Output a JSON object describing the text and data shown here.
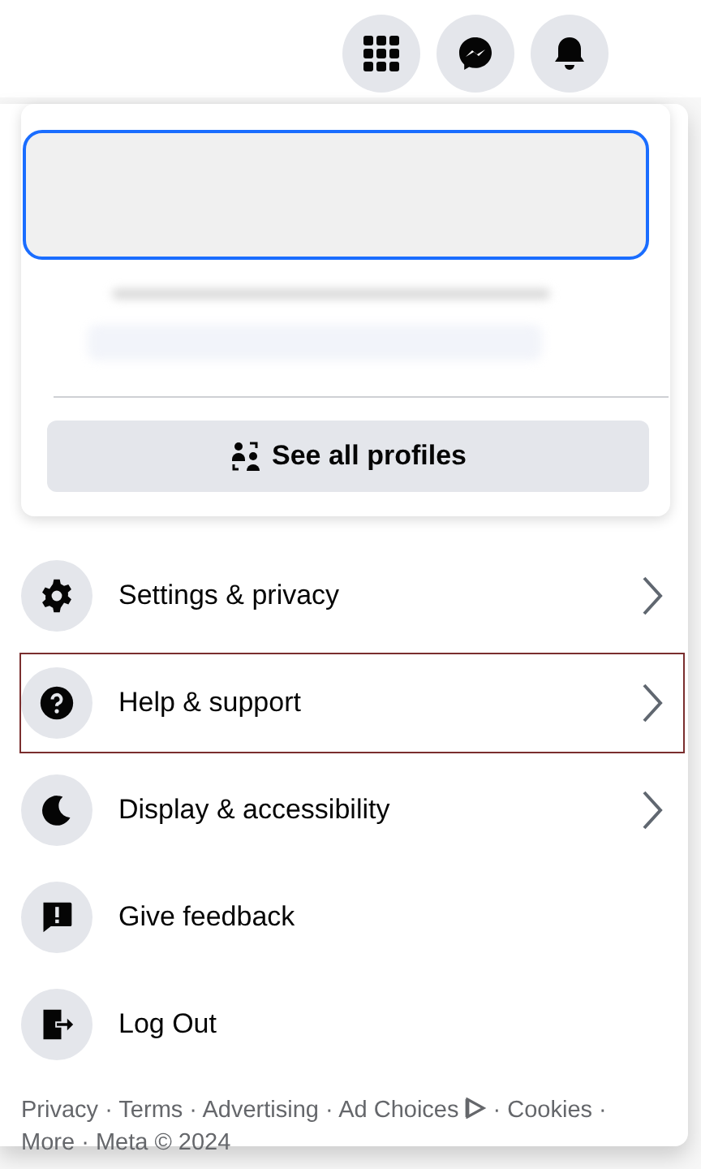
{
  "top_bar": {
    "buttons": [
      {
        "kind": "menu"
      },
      {
        "kind": "messenger"
      },
      {
        "kind": "notifications"
      }
    ]
  },
  "profile_card": {
    "focused": true,
    "button": "See all profiles"
  },
  "menu": [
    {
      "label": "Settings & privacy",
      "kind": "settings",
      "has_submenu": true,
      "selected": false
    },
    {
      "label": "Help & support",
      "kind": "help",
      "has_submenu": true,
      "selected": true
    },
    {
      "label": "Display & accessibility",
      "kind": "display",
      "has_submenu": true,
      "selected": false
    },
    {
      "label": "Give feedback",
      "kind": "feedback",
      "has_submenu": false,
      "selected": false
    },
    {
      "label": "Log Out",
      "kind": "logout",
      "has_submenu": false,
      "selected": false
    }
  ],
  "footer": {
    "links": [
      {
        "label": "Privacy"
      },
      {
        "label": "Terms"
      },
      {
        "label": "Advertising"
      },
      {
        "label": "Ad Choices",
        "ad_icon": true
      },
      {
        "label": "Cookies"
      },
      {
        "label": "More"
      }
    ],
    "separator": "·",
    "copyright": "Meta © 2024"
  }
}
